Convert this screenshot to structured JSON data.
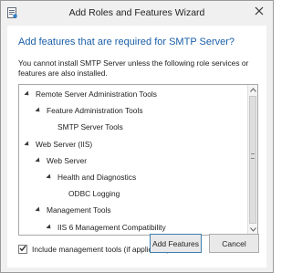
{
  "window": {
    "title": "Add Roles and Features Wizard"
  },
  "dialog": {
    "heading": "Add features that are required for SMTP Server?",
    "description": "You cannot install SMTP Server unless the following role services or features are also installed."
  },
  "tree": [
    {
      "label": "Remote Server Administration Tools",
      "level": 0,
      "expanded": true
    },
    {
      "label": "Feature Administration Tools",
      "level": 1,
      "expanded": true
    },
    {
      "label": "SMTP Server Tools",
      "level": 2,
      "expanded": false
    },
    {
      "label": "Web Server (IIS)",
      "level": 0,
      "expanded": true
    },
    {
      "label": "Web Server",
      "level": 1,
      "expanded": true
    },
    {
      "label": "Health and Diagnostics",
      "level": 2,
      "expanded": true
    },
    {
      "label": "ODBC Logging",
      "level": 3,
      "expanded": false
    },
    {
      "label": "Management Tools",
      "level": 1,
      "expanded": true
    },
    {
      "label": "IIS 6 Management Compatibility",
      "level": 2,
      "expanded": true
    }
  ],
  "options": {
    "include_mgmt_label": "Include management tools (if applicable)",
    "include_mgmt_checked": true
  },
  "buttons": {
    "add_label": "Add Features",
    "cancel_label": "Cancel"
  },
  "icons": {
    "app": "wizard-app-icon",
    "close": "close-icon",
    "expand": "triangle-expanded-icon",
    "scroll_up": "chevron-up-icon",
    "scroll_down": "chevron-down-icon",
    "check": "checkmark-icon"
  }
}
